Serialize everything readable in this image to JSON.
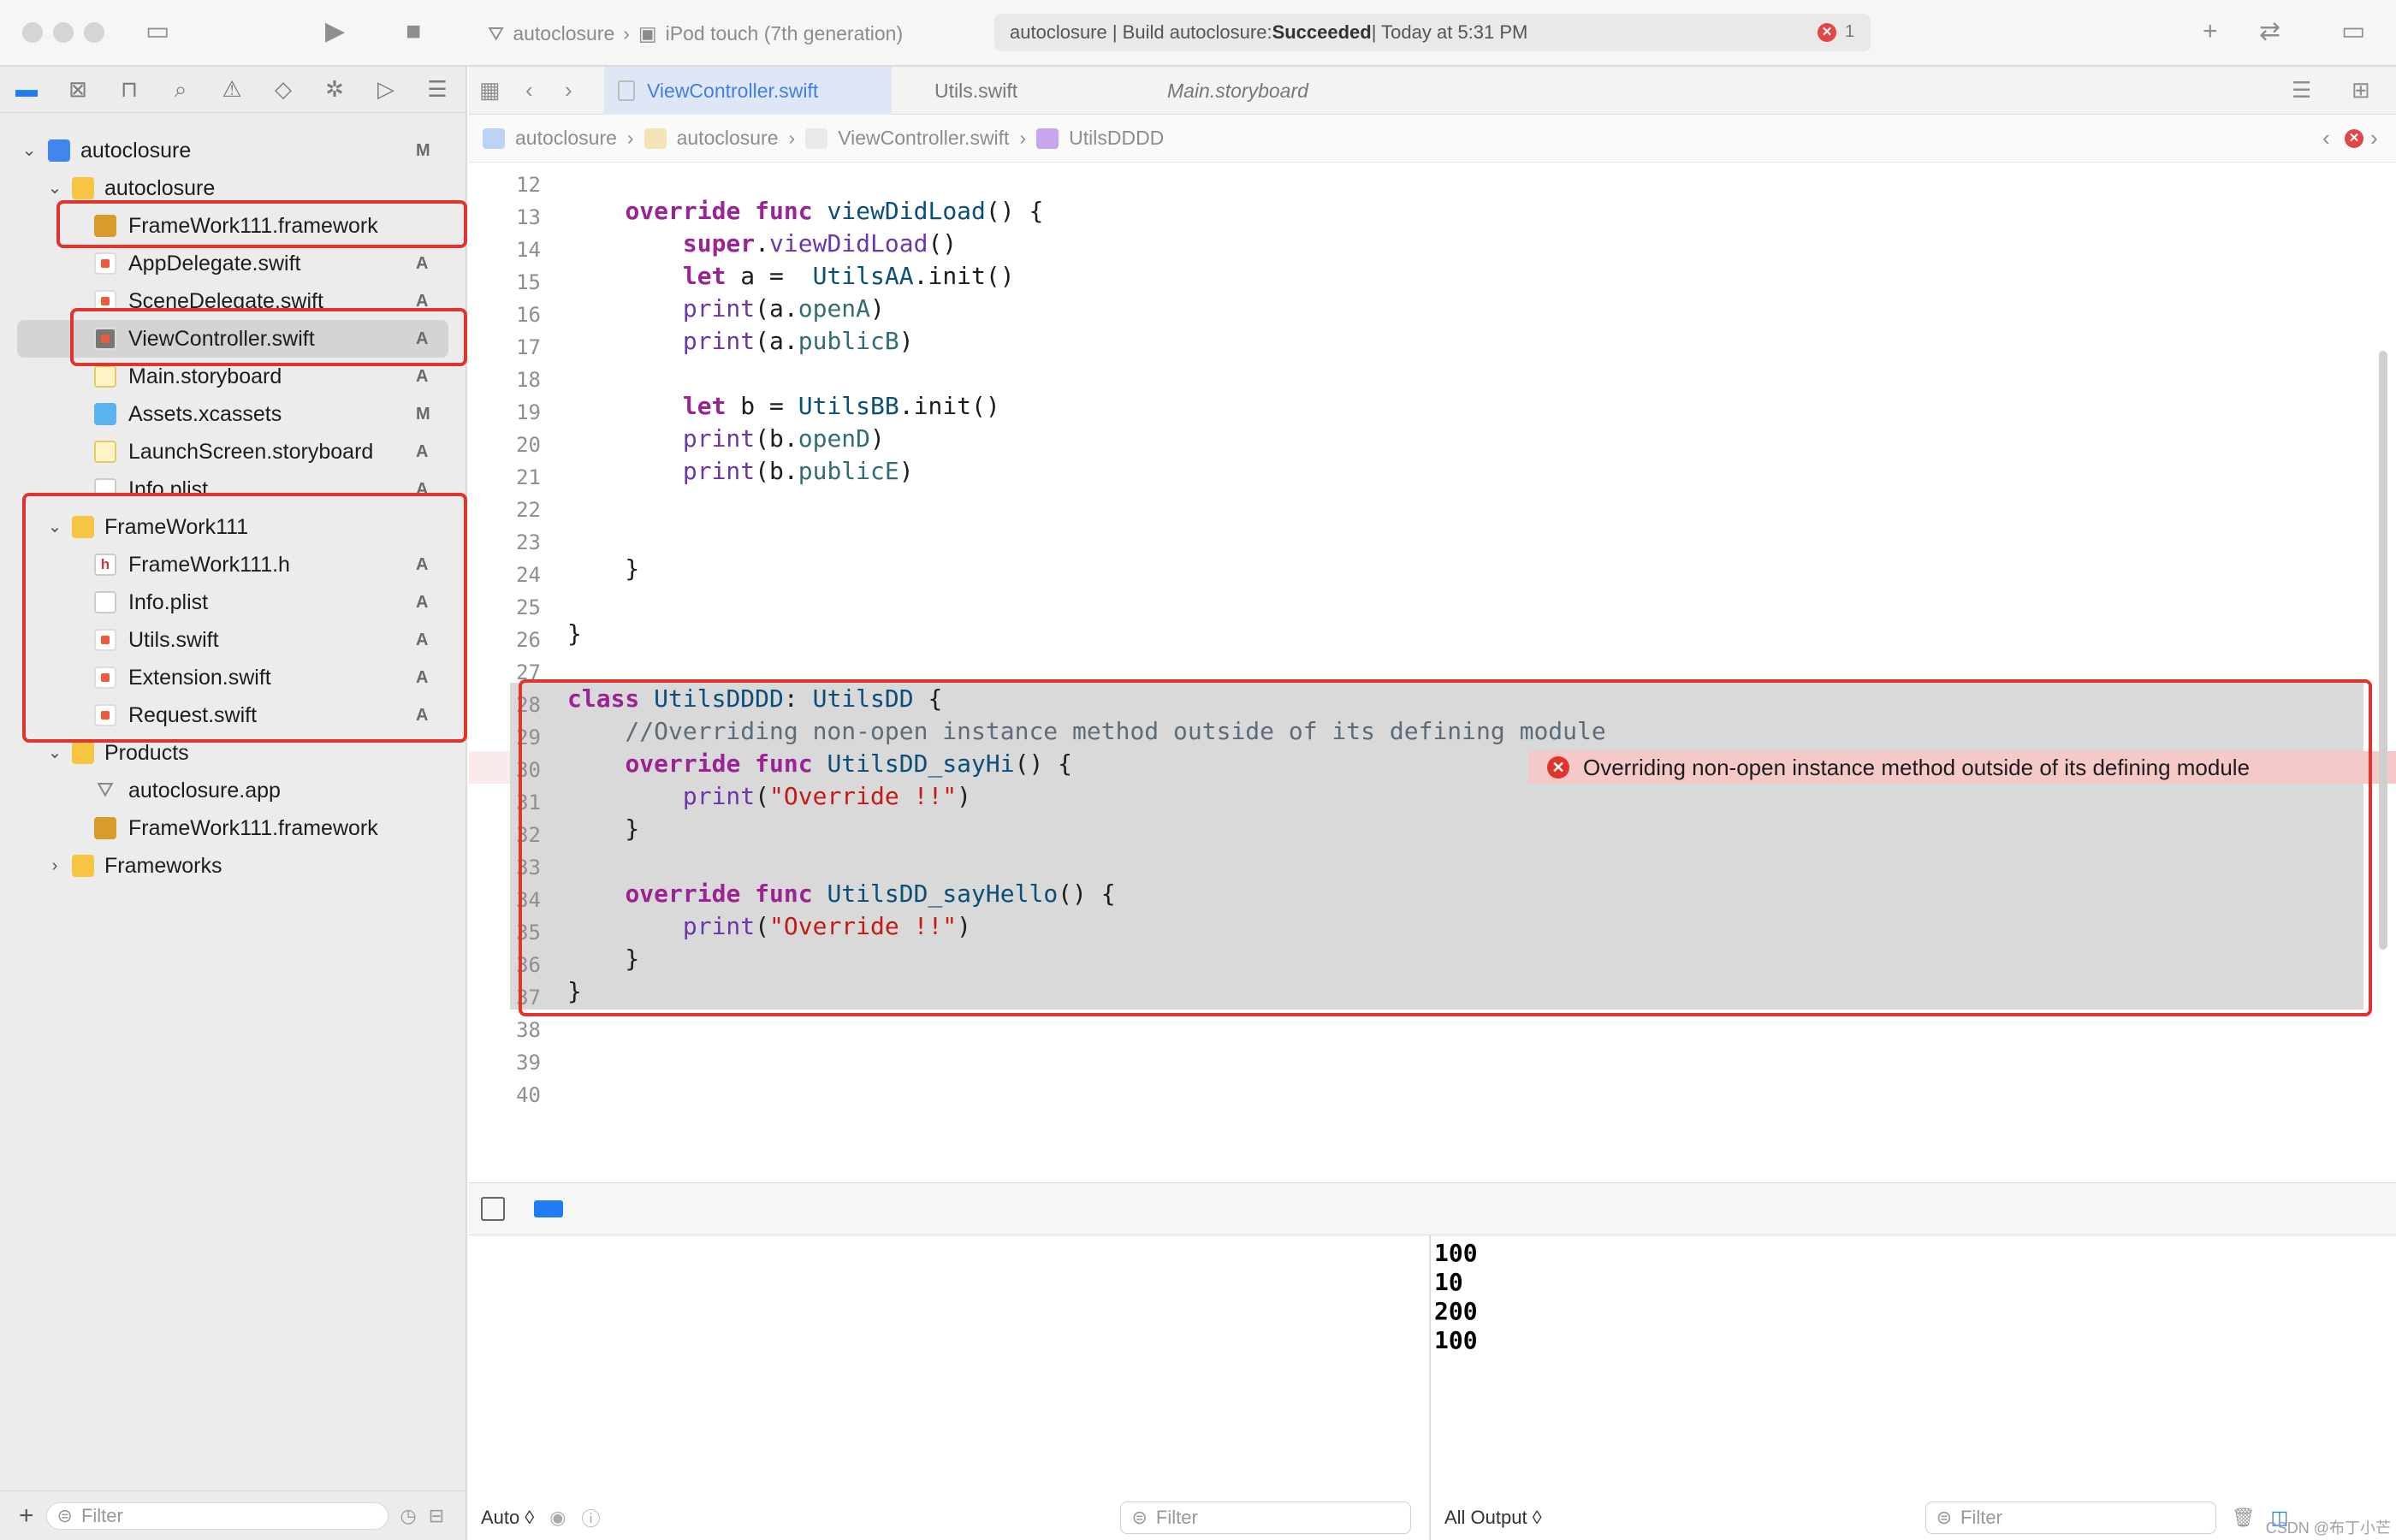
{
  "toolbar": {
    "scheme_project": "autoclosure",
    "scheme_device": "iPod touch (7th generation)",
    "activity_prefix": "autoclosure | Build autoclosure: ",
    "activity_status": "Succeeded",
    "activity_suffix": " | Today at 5:31 PM",
    "error_count": "1"
  },
  "navigator": {
    "rows": [
      {
        "label": "autoclosure",
        "status": "M"
      },
      {
        "label": "autoclosure",
        "status": ""
      },
      {
        "label": "FrameWork111.framework",
        "status": ""
      },
      {
        "label": "AppDelegate.swift",
        "status": "A"
      },
      {
        "label": "SceneDelegate.swift",
        "status": "A"
      },
      {
        "label": "ViewController.swift",
        "status": "A"
      },
      {
        "label": "Main.storyboard",
        "status": "A"
      },
      {
        "label": "Assets.xcassets",
        "status": "M"
      },
      {
        "label": "LaunchScreen.storyboard",
        "status": "A"
      },
      {
        "label": "Info.plist",
        "status": "A"
      },
      {
        "label": "FrameWork111",
        "status": ""
      },
      {
        "label": "FrameWork111.h",
        "status": "A"
      },
      {
        "label": "Info.plist",
        "status": "A"
      },
      {
        "label": "Utils.swift",
        "status": "A"
      },
      {
        "label": "Extension.swift",
        "status": "A"
      },
      {
        "label": "Request.swift",
        "status": "A"
      },
      {
        "label": "Products",
        "status": ""
      },
      {
        "label": "autoclosure.app",
        "status": ""
      },
      {
        "label": "FrameWork111.framework",
        "status": ""
      },
      {
        "label": "Frameworks",
        "status": ""
      }
    ],
    "filter_placeholder": "Filter"
  },
  "tabs": [
    "ViewController.swift",
    "Utils.swift",
    "Main.storyboard"
  ],
  "jumpbar": [
    "autoclosure",
    "autoclosure",
    "ViewController.swift",
    "UtilsDDDD"
  ],
  "editor": {
    "line_numbers": [
      "12",
      "13",
      "14",
      "15",
      "16",
      "17",
      "18",
      "19",
      "20",
      "21",
      "22",
      "23",
      "24",
      "25",
      "26",
      "27",
      "28",
      "29",
      "30",
      "31",
      "32",
      "33",
      "34",
      "35",
      "36",
      "37",
      "38",
      "39",
      "40"
    ],
    "error_message": "Overriding non-open instance method outside of its defining module"
  },
  "debug": {
    "output": [
      "100",
      "10",
      "200",
      "100"
    ],
    "auto_label": "Auto ◊",
    "filter_placeholder": "Filter",
    "all_output_label": "All Output ◊",
    "watermark": "CSDN @布丁小芒"
  },
  "colors": {
    "accent": "#1f7cf3",
    "highlight_red": "#e0352c",
    "selection_gray": "#d9d9d9"
  }
}
